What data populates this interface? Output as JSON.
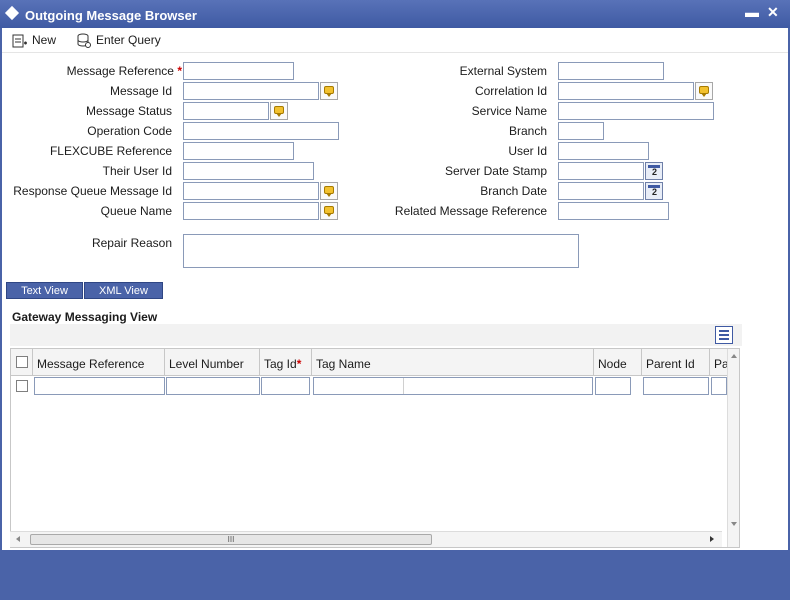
{
  "window": {
    "title": "Outgoing Message Browser",
    "minimize": "▬",
    "close": "✕"
  },
  "toolbar": {
    "new_label": "New",
    "enter_query_label": "Enter Query"
  },
  "form": {
    "left": {
      "message_reference": "Message Reference",
      "message_id": "Message Id",
      "message_status": "Message Status",
      "operation_code": "Operation Code",
      "flexcube_reference": "FLEXCUBE Reference",
      "their_user_id": "Their User Id",
      "response_queue_message_id": "Response Queue Message Id",
      "queue_name": "Queue Name",
      "repair_reason": "Repair Reason"
    },
    "right": {
      "external_system": "External System",
      "correlation_id": "Correlation Id",
      "service_name": "Service Name",
      "branch": "Branch",
      "user_id": "User Id",
      "server_date_stamp": "Server Date Stamp",
      "branch_date": "Branch Date",
      "related_message_reference": "Related Message Reference"
    },
    "required_mark": "*"
  },
  "tabs": {
    "text_view": "Text View",
    "xml_view": "XML View"
  },
  "gateway": {
    "title": "Gateway Messaging View",
    "columns": [
      "Message Reference",
      "Level Number",
      "Tag Id",
      "Tag Name",
      "Node",
      "Parent Id",
      "Pa"
    ],
    "tag_id_required": "*"
  },
  "scroll": {
    "thumb_grip": "III"
  },
  "colors": {
    "frame": "#4a63a8",
    "required": "#cc0000"
  }
}
